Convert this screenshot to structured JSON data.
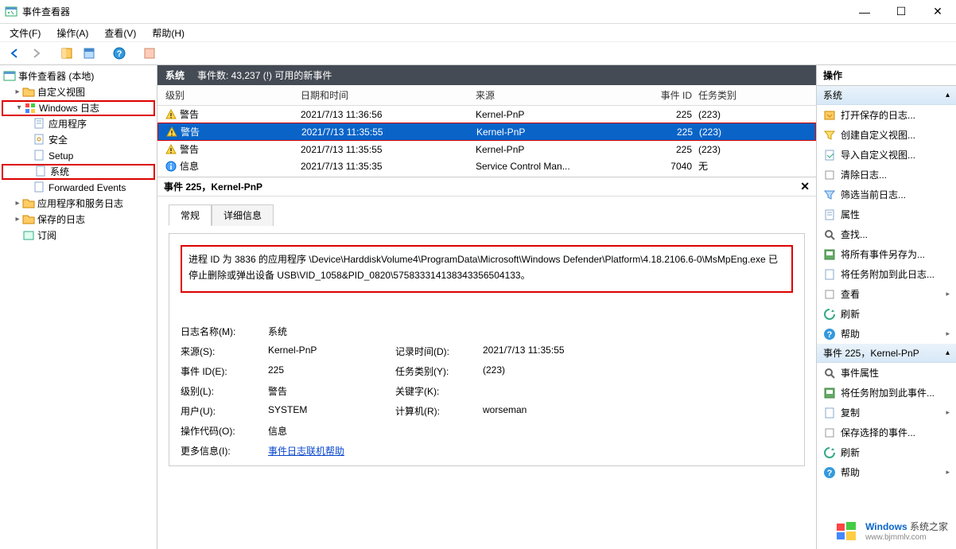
{
  "window": {
    "title": "事件查看器",
    "min": "—",
    "max": "☐",
    "close": "✕"
  },
  "menu": {
    "file": "文件(F)",
    "action": "操作(A)",
    "view": "查看(V)",
    "help": "帮助(H)"
  },
  "tree": {
    "root": "事件查看器 (本地)",
    "customViews": "自定义视图",
    "winLogs": "Windows 日志",
    "app": "应用程序",
    "security": "安全",
    "setup": "Setup",
    "system": "系统",
    "forwarded": "Forwarded Events",
    "appServices": "应用程序和服务日志",
    "savedLogs": "保存的日志",
    "subscriptions": "订阅"
  },
  "center": {
    "headerName": "系统",
    "headerCount": "事件数: 43,237 (!) 可用的新事件",
    "cols": {
      "level": "级别",
      "date": "日期和时间",
      "src": "来源",
      "id": "事件 ID",
      "cat": "任务类别"
    },
    "rows": [
      {
        "level": "警告",
        "date": "2021/7/13 11:36:56",
        "src": "Kernel-PnP",
        "id": "225",
        "cat": "(223)",
        "type": "warn"
      },
      {
        "level": "警告",
        "date": "2021/7/13 11:35:55",
        "src": "Kernel-PnP",
        "id": "225",
        "cat": "(223)",
        "type": "warn",
        "selected": true
      },
      {
        "level": "警告",
        "date": "2021/7/13 11:35:55",
        "src": "Kernel-PnP",
        "id": "225",
        "cat": "(223)",
        "type": "warn"
      },
      {
        "level": "信息",
        "date": "2021/7/13 11:35:35",
        "src": "Service Control Man...",
        "id": "7040",
        "cat": "无",
        "type": "info"
      }
    ]
  },
  "detail": {
    "header": "事件 225，Kernel-PnP",
    "tabGeneral": "常规",
    "tabDetails": "详细信息",
    "message": "进程 ID 为 3836 的应用程序 \\Device\\HarddiskVolume4\\ProgramData\\Microsoft\\Windows Defender\\Platform\\4.18.2106.6-0\\MsMpEng.exe 已停止删除或弹出设备 USB\\VID_1058&PID_0820\\575833314138343356504133。",
    "labels": {
      "logName": "日志名称(M):",
      "source": "来源(S):",
      "eventId": "事件 ID(E):",
      "level": "级别(L):",
      "user": "用户(U):",
      "opcode": "操作代码(O):",
      "moreInfo": "更多信息(I):",
      "logged": "记录时间(D):",
      "taskCat": "任务类别(Y):",
      "keywords": "关键字(K):",
      "computer": "计算机(R):"
    },
    "values": {
      "logName": "系统",
      "source": "Kernel-PnP",
      "eventId": "225",
      "level": "警告",
      "user": "SYSTEM",
      "opcode": "信息",
      "moreInfoLink": "事件日志联机帮助",
      "logged": "2021/7/13 11:35:55",
      "taskCat": "(223)",
      "keywords": "",
      "computer": "worseman"
    }
  },
  "actions": {
    "header": "操作",
    "section1": "系统",
    "items1": [
      "打开保存的日志...",
      "创建自定义视图...",
      "导入自定义视图...",
      "清除日志...",
      "筛选当前日志...",
      "属性",
      "查找...",
      "将所有事件另存为...",
      "将任务附加到此日志...",
      "查看",
      "刷新",
      "帮助"
    ],
    "section2": "事件 225，Kernel-PnP",
    "items2": [
      "事件属性",
      "将任务附加到此事件...",
      "复制",
      "保存选择的事件...",
      "刷新",
      "帮助"
    ]
  },
  "watermark": {
    "brand": "Windows",
    "tail": "系统之家",
    "url": "www.bjmmlv.com"
  }
}
